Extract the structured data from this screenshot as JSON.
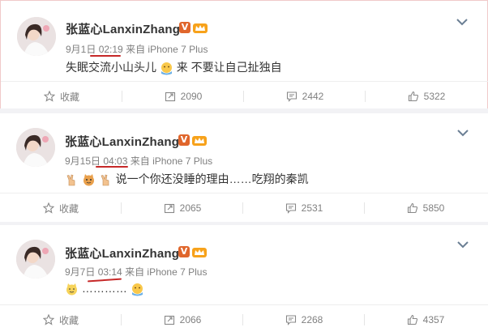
{
  "posts": [
    {
      "username": "张蓝心LanxinZhang",
      "verified_badge": "V",
      "date": "9月1日",
      "time": "02:19",
      "source": "来自 iPhone 7 Plus",
      "text_before": "失眠交流小山头儿",
      "text_after": "来 不要让自己扯独自",
      "actions": {
        "favorite": "收藏",
        "repost": "2090",
        "comment": "2442",
        "like": "5322"
      }
    },
    {
      "username": "张蓝心LanxinZhang",
      "verified_badge": "V",
      "date": "9月15日",
      "time": "04:03",
      "source": "来自 iPhone 7 Plus",
      "text": "说一个你还没睡的理由……吃翔的秦凯",
      "actions": {
        "favorite": "收藏",
        "repost": "2065",
        "comment": "2531",
        "like": "5850"
      }
    },
    {
      "username": "张蓝心LanxinZhang",
      "verified_badge": "V",
      "date": "9月7日",
      "time": "03:14",
      "source": "来自 iPhone 7 Plus",
      "text": "…………",
      "actions": {
        "favorite": "收藏",
        "repost": "2066",
        "comment": "2268",
        "like": "4357"
      }
    }
  ],
  "icons": [
    "avatar-photo",
    "verified-v-icon",
    "vip-crown-icon",
    "chevron-down-icon",
    "star-icon",
    "repost-icon",
    "comment-icon",
    "thumbs-up-icon",
    "emoji-icon"
  ],
  "colors": {
    "accent_red": "#c62828",
    "badge_orange": "#e0662c",
    "meta_gray": "#808080"
  }
}
